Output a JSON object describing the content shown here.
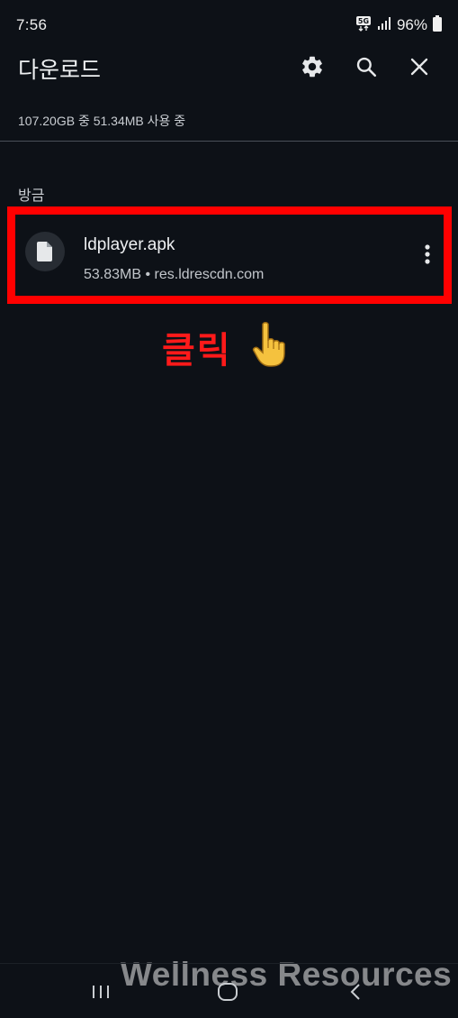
{
  "status_bar": {
    "time": "7:56",
    "network_badge": "5G",
    "battery": "96%",
    "icons": [
      "network-5g-icon",
      "signal-icon",
      "battery-icon"
    ]
  },
  "app_bar": {
    "title": "다운로드",
    "actions": [
      "settings-gear-icon",
      "search-icon",
      "close-icon"
    ]
  },
  "storage_info": "107.20GB 중 51.34MB 사용 중",
  "section": {
    "label": "방금",
    "files": [
      {
        "name": "ldplayer.apk",
        "meta": "53.83MB • res.ldrescdn.com",
        "icon": "file-icon",
        "menu_icon": "more-vert-icon"
      }
    ]
  },
  "annotation": {
    "text": "클릭",
    "icon": "pointing-hand-emoji",
    "color": "#ff1a1a",
    "highlight_color": "#ff0000"
  },
  "watermark": "Wellness Resources",
  "nav_bar": [
    "recent-apps-icon",
    "home-icon",
    "back-icon"
  ],
  "colors": {
    "background": "#0d1117",
    "text": "#eef0f2",
    "secondary_text": "#c2c6cb"
  }
}
